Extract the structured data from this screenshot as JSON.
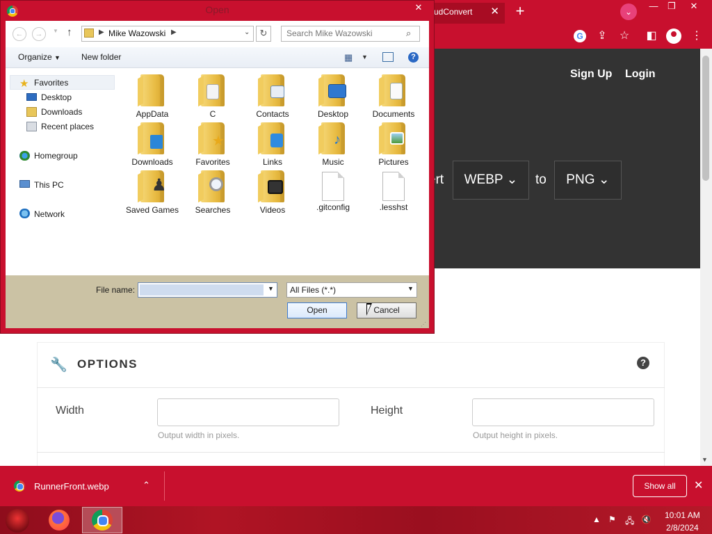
{
  "browser": {
    "active_tab_title": "udConvert",
    "tab_close": "✕",
    "new_tab": "+",
    "nav": {
      "signup": "Sign Up",
      "login": "Login"
    },
    "converter": {
      "convert_word": "ert",
      "from_format": "WEBP",
      "to_word": "to",
      "to_format": "PNG"
    },
    "options": {
      "title": "OPTIONS",
      "width_label": "Width",
      "width_hint": "Output width in pixels.",
      "height_label": "Height",
      "height_hint": "Output height in pixels."
    },
    "download": {
      "file_name": "RunnerFront.webp",
      "show_all": "Show all",
      "close": "✕"
    }
  },
  "dialog": {
    "title": "Open",
    "close": "✕",
    "address_path": "Mike Wazowski",
    "search_placeholder": "Search Mike Wazowski",
    "commands": {
      "organize": "Organize",
      "new_folder": "New folder"
    },
    "nav_items": [
      {
        "label": "Favorites",
        "icon": "star-icon"
      },
      {
        "label": "Desktop",
        "icon": "desktop-icon"
      },
      {
        "label": "Downloads",
        "icon": "downloads-icon"
      },
      {
        "label": "Recent places",
        "icon": "recent-places-icon"
      },
      {
        "label": "Homegroup",
        "icon": "homegroup-icon"
      },
      {
        "label": "This PC",
        "icon": "computer-icon"
      },
      {
        "label": "Network",
        "icon": "network-icon"
      }
    ],
    "files": [
      {
        "label": "AppData",
        "type": "folder"
      },
      {
        "label": "C",
        "type": "folder"
      },
      {
        "label": "Contacts",
        "type": "folder"
      },
      {
        "label": "Desktop",
        "type": "folder"
      },
      {
        "label": "Documents",
        "type": "folder"
      },
      {
        "label": "Downloads",
        "type": "folder"
      },
      {
        "label": "Favorites",
        "type": "folder"
      },
      {
        "label": "Links",
        "type": "folder"
      },
      {
        "label": "Music",
        "type": "folder"
      },
      {
        "label": "Pictures",
        "type": "folder"
      },
      {
        "label": "Saved Games",
        "type": "folder"
      },
      {
        "label": "Searches",
        "type": "folder"
      },
      {
        "label": "Videos",
        "type": "folder"
      },
      {
        "label": ".gitconfig",
        "type": "file"
      },
      {
        "label": ".lesshst",
        "type": "file"
      }
    ],
    "file_name_label": "File name:",
    "file_name_value": "",
    "file_type": "All Files (*.*)",
    "open_button": "Open",
    "cancel_button": "Cancel"
  },
  "taskbar": {
    "time": "10:01 AM",
    "date": "2/8/2024"
  },
  "colors": {
    "accent": "#c8102e",
    "hero": "#333333",
    "dialog_footer": "#cbc2a4"
  }
}
